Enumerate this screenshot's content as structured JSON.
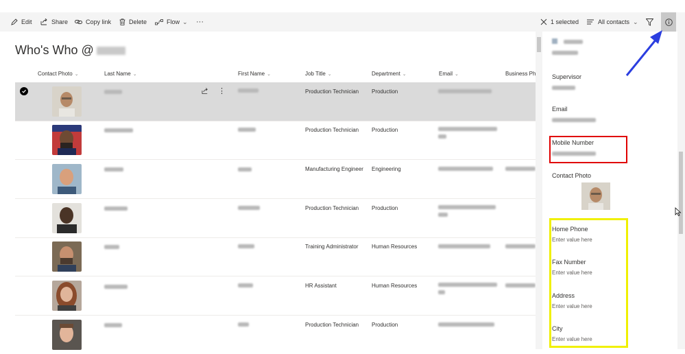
{
  "commandbar": {
    "edit": "Edit",
    "share": "Share",
    "copy_link": "Copy link",
    "delete": "Delete",
    "flow": "Flow",
    "more": "···",
    "selected": "1 selected",
    "view": "All contacts"
  },
  "page": {
    "title": "Who's Who @"
  },
  "columns": {
    "contact_photo": "Contact Photo",
    "last_name": "Last Name",
    "first_name": "First Name",
    "job_title": "Job Title",
    "department": "Department",
    "email": "Email",
    "business_phone": "Business Pho"
  },
  "rows": [
    {
      "job_title": "Production Technician",
      "department": "Production",
      "selected": true
    },
    {
      "job_title": "Production Technician",
      "department": "Production",
      "selected": false
    },
    {
      "job_title": "Manufacturing Engineer",
      "department": "Engineering",
      "selected": false
    },
    {
      "job_title": "Production Technician",
      "department": "Production",
      "selected": false
    },
    {
      "job_title": "Training Administrator",
      "department": "Human Resources",
      "selected": false
    },
    {
      "job_title": "HR Assistant",
      "department": "Human Resources",
      "selected": false
    },
    {
      "job_title": "Production Technician",
      "department": "Production",
      "selected": false
    }
  ],
  "panel": {
    "supervisor_label": "Supervisor",
    "email_label": "Email",
    "mobile_label": "Mobile Number",
    "contact_photo_label": "Contact Photo",
    "home_phone_label": "Home Phone",
    "home_phone_placeholder": "Enter value here",
    "fax_label": "Fax Number",
    "fax_placeholder": "Enter value here",
    "address_label": "Address",
    "address_placeholder": "Enter value here",
    "city_label": "City",
    "city_placeholder": "Enter value here"
  },
  "colors": {
    "highlight_red": "#e00000",
    "highlight_yellow": "#f0f000",
    "arrow_blue": "#2b3ee0",
    "selected_row": "#dadada"
  }
}
